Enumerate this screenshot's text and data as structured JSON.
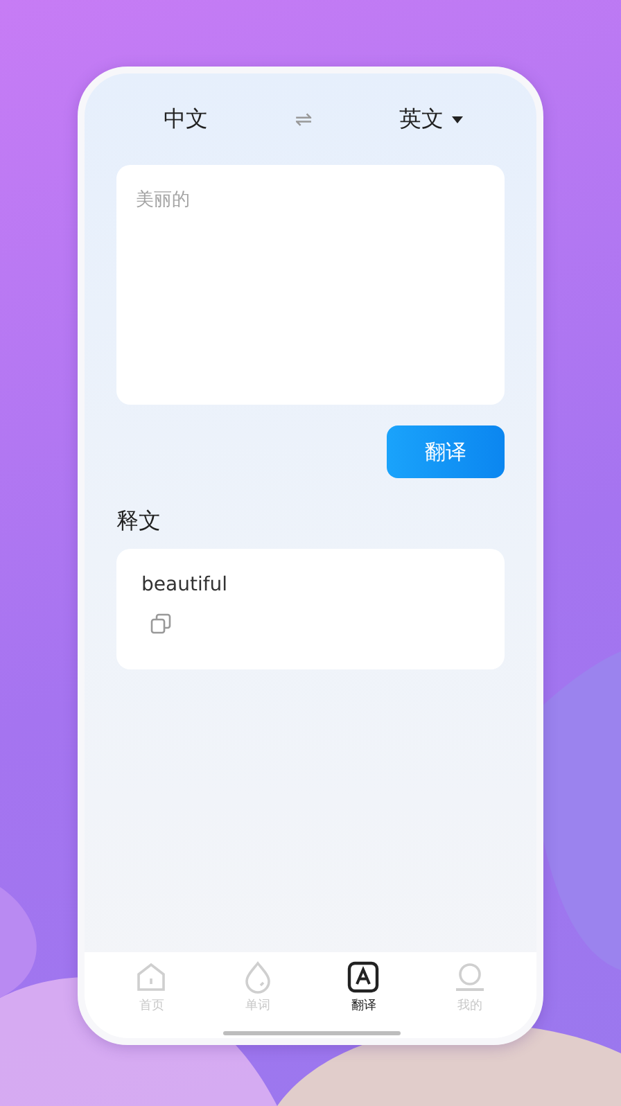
{
  "header": {
    "source_language": "中文",
    "swap_icon": "⇌",
    "target_language": "英文"
  },
  "input": {
    "placeholder": "美丽的"
  },
  "translate_button": "翻译",
  "result": {
    "title": "释文",
    "text": "beautiful"
  },
  "tabs": [
    {
      "label": "首页",
      "kind": "home",
      "selected": false
    },
    {
      "label": "单词",
      "kind": "drop",
      "selected": false
    },
    {
      "label": "翻译",
      "kind": "translate",
      "selected": true
    },
    {
      "label": "我的",
      "kind": "profile",
      "selected": false
    }
  ]
}
